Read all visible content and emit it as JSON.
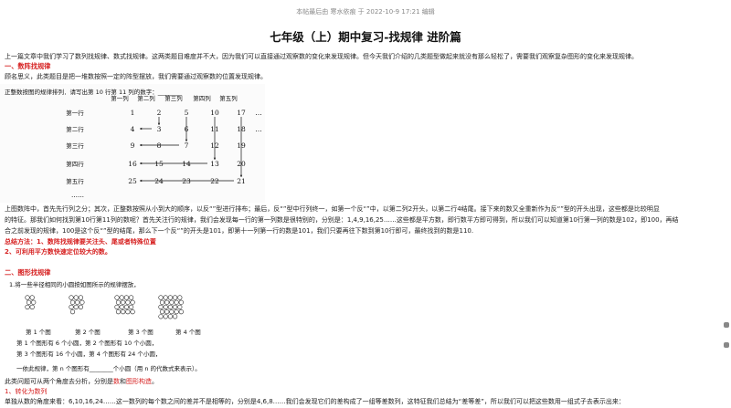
{
  "meta": {
    "source": "本帖最后由 寒水依痕 于 2022-10-9 17:21 编辑"
  },
  "article": {
    "title": "七年级（上）期中复习-找规律 进阶篇",
    "intro": "上一篇文章中我们学习了数列找规律、数式找规律。这两类题目难度并不大，因为我们可以直接通过观察数的变化来发现规律。但今天我们介绍的几类题型做起来就没有那么轻松了，需要我们观察复杂图形的变化来发现规律。",
    "sec1": {
      "heading": "一、数阵找规律",
      "desc": "顾名思义，此类题目是把一堆数按照一定的阵型摆放，我们需要通过观察数的位置发现规律。",
      "fig_caption": "正整数按图的规律排列．请写出第 10 行第 11 列的数字：________",
      "col_headers": [
        "第一列",
        "第二列",
        "第三列",
        "第四列",
        "第五列"
      ],
      "row_headers": [
        "第一行",
        "第二行",
        "第三行",
        "第四行",
        "第五行"
      ],
      "grid": [
        [
          "1",
          "2",
          "5",
          "10",
          "17"
        ],
        [
          "4",
          "3",
          "6",
          "11",
          "18"
        ],
        [
          "9",
          "8",
          "7",
          "12",
          "19"
        ],
        [
          "16",
          "15",
          "14",
          "13",
          "20"
        ],
        [
          "25",
          "24",
          "23",
          "22",
          "21"
        ]
      ],
      "ellipsis": "……",
      "explain1": "上图数阵中，首先先行列之分；其次，正整数按照从小到大的顺序，以反“”型进行排布；最后，反“”型中行列终一，如第一个反“”中，以第二列2开头，以第二行4结尾。接下来的数又全重新作为反“”型的开头出现，这些都是比较明显",
      "explain2": "的特征。那我们如何找到第10行第11列的数呢？首先关注行的规律，我们会发现每一行的第一列数是很特别的，分别是：1,4,9,16,25……这些都是平方数，即行数平方即可得到，所以我们可以知道第10行第一列的数是102，即100，再结",
      "explain3": "合之前发现的规律，100是这个反“”型的结尾，那么下一个反“”的开头是101，即第十一列第一行的数是101，我们只要再往下数到第10行即可，最终找到的数是110.",
      "summary_label": "总结方法：",
      "summary1": "1、数阵找规律要关注头、尾或者特殊位置",
      "summary2": "2、可利用平方数快速定位较大的数。"
    },
    "sec2": {
      "heading": "二、图形找规律",
      "q": "1.将一些半径相同的小圆按如图所示的规律摆放，",
      "fig_labels": [
        "第 1 个图",
        "第 2 个图",
        "第 3 个图",
        "第 4 个图"
      ],
      "line1": "第 1 个图形有 6 个小圆，第 2 个图形有 10 个小圆，",
      "line2": "第 3 个图形有 16 个小圆，第 4 个图形有 24 个小圆，",
      "line3": "一依此规律，第 n 个图形有________个小圆（用 n 的代数式来表示）。",
      "note_pre": "此类问题可从两个角度去分析，分别是",
      "note_a": "数",
      "note_mid": "和",
      "note_b": "图形构造",
      "note_end": "。",
      "sub1": "1、转化为数列",
      "last": "单独从数的角度来看：6,10,16,24……这一数列的每个数之间的差并不是相等的，分别是4,6,8……我们会发现它们的差构成了一组等差数列，这特征我们总结为“差等差”，所以我们可以把这些数用一组式子去表示出来："
    }
  },
  "colors": {
    "accent": "#d62020",
    "text": "#222222",
    "muted": "#888888"
  }
}
